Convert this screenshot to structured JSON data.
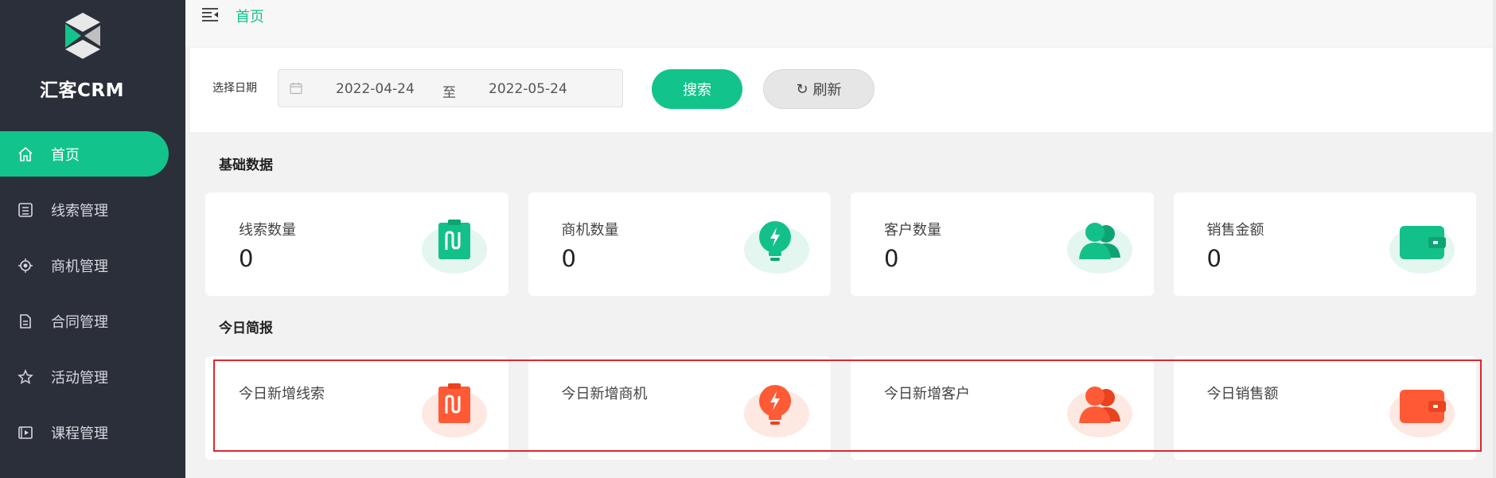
{
  "app": {
    "brand": "汇客CRM"
  },
  "sidebar": {
    "items": [
      {
        "label": "首页",
        "icon": "home-icon",
        "active": true
      },
      {
        "label": "线索管理",
        "icon": "clue-icon",
        "active": false
      },
      {
        "label": "商机管理",
        "icon": "opportunity-icon",
        "active": false
      },
      {
        "label": "合同管理",
        "icon": "contract-icon",
        "active": false
      },
      {
        "label": "活动管理",
        "icon": "star-icon",
        "active": false
      },
      {
        "label": "课程管理",
        "icon": "course-icon",
        "active": false
      }
    ]
  },
  "breadcrumb": {
    "home": "首页"
  },
  "filter": {
    "label": "选择日期",
    "start_date": "2022-04-24",
    "separator": "至",
    "end_date": "2022-05-24",
    "search_label": "搜索",
    "refresh_label": "刷新"
  },
  "basic": {
    "title": "基础数据",
    "cards": [
      {
        "label": "线索数量",
        "value": "0",
        "icon": "clipboard-icon"
      },
      {
        "label": "商机数量",
        "value": "0",
        "icon": "lightbulb-icon"
      },
      {
        "label": "客户数量",
        "value": "0",
        "icon": "users-icon"
      },
      {
        "label": "销售金额",
        "value": "0",
        "icon": "wallet-icon"
      }
    ]
  },
  "today": {
    "title": "今日简报",
    "cards": [
      {
        "label": "今日新增线索",
        "icon": "clipboard-icon"
      },
      {
        "label": "今日新增商机",
        "icon": "lightbulb-icon"
      },
      {
        "label": "今日新增客户",
        "icon": "users-icon"
      },
      {
        "label": "今日销售额",
        "icon": "wallet-icon"
      }
    ]
  },
  "colors": {
    "accent": "#12c48b",
    "sidebar_bg": "#2b2f3a",
    "today_icon": "#ff5a36",
    "highlight_border": "#e0262f"
  }
}
